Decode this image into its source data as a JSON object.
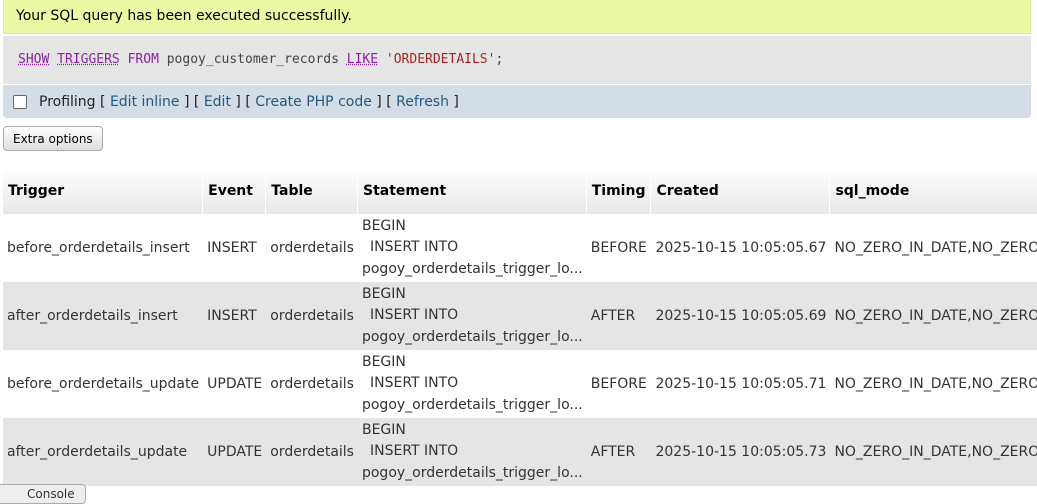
{
  "message": "Your SQL query has been executed successfully.",
  "sql": {
    "kw_show": "SHOW",
    "kw_triggers": "TRIGGERS",
    "kw_from": "FROM",
    "db": "pogoy_customer_records",
    "kw_like": "LIKE",
    "pattern": "'ORDERDETAILS'",
    "end": ";"
  },
  "profiling": {
    "label": "Profiling",
    "edit_inline": "Edit inline",
    "edit": "Edit",
    "create_php": "Create PHP code",
    "refresh": "Refresh"
  },
  "extra_options": "Extra options",
  "table": {
    "headers": [
      "Trigger",
      "Event",
      "Table",
      "Statement",
      "Timing",
      "Created",
      "sql_mode"
    ],
    "rows": [
      {
        "trigger": "before_orderdetails_insert",
        "event": "INSERT",
        "table": "orderdetails",
        "stmt1": "BEGIN",
        "stmt2": "INSERT INTO",
        "stmt3": "pogoy_orderdetails_trigger_lo...",
        "timing": "BEFORE",
        "created": "2025-10-15 10:05:05.67",
        "sql_mode": "NO_ZERO_IN_DATE,NO_ZERO_DATE"
      },
      {
        "trigger": "after_orderdetails_insert",
        "event": "INSERT",
        "table": "orderdetails",
        "stmt1": "BEGIN",
        "stmt2": "INSERT INTO",
        "stmt3": "pogoy_orderdetails_trigger_lo...",
        "timing": "AFTER",
        "created": "2025-10-15 10:05:05.69",
        "sql_mode": "NO_ZERO_IN_DATE,NO_ZERO_DATE"
      },
      {
        "trigger": "before_orderdetails_update",
        "event": "UPDATE",
        "table": "orderdetails",
        "stmt1": "BEGIN",
        "stmt2": "INSERT INTO",
        "stmt3": "pogoy_orderdetails_trigger_lo...",
        "timing": "BEFORE",
        "created": "2025-10-15 10:05:05.71",
        "sql_mode": "NO_ZERO_IN_DATE,NO_ZERO_DATE"
      },
      {
        "trigger": "after_orderdetails_update",
        "event": "UPDATE",
        "table": "orderdetails",
        "stmt1": "BEGIN",
        "stmt2": "INSERT INTO",
        "stmt3": "pogoy_orderdetails_trigger_lo...",
        "timing": "AFTER",
        "created": "2025-10-15 10:05:05.73",
        "sql_mode": "NO_ZERO_IN_DATE,NO_ZERO_DATE"
      }
    ]
  },
  "console_label": "Console"
}
